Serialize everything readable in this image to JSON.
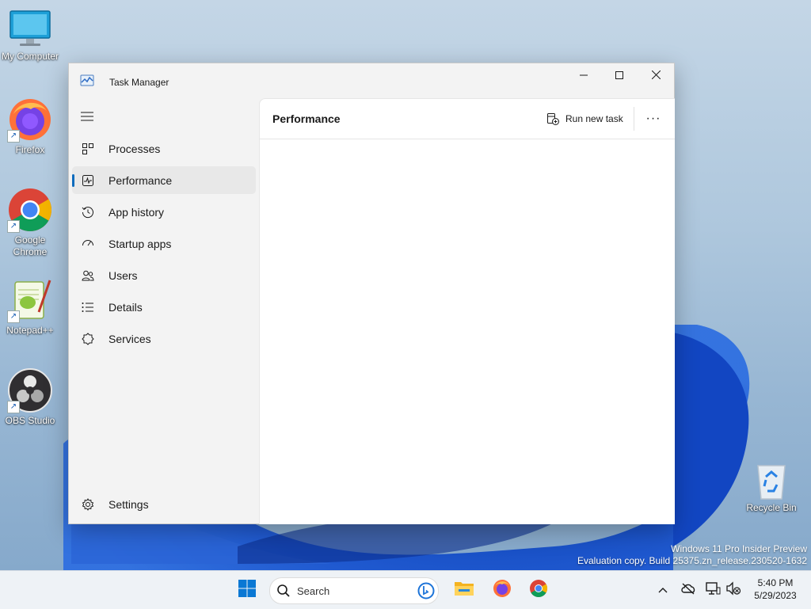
{
  "desktop": {
    "icons": [
      {
        "label": "My Computer"
      },
      {
        "label": "Firefox"
      },
      {
        "label": "Google Chrome"
      },
      {
        "label": "Notepad++"
      },
      {
        "label": "OBS Studio"
      },
      {
        "label": "Recycle Bin"
      }
    ],
    "watermark": {
      "line1": "Windows 11 Pro Insider Preview",
      "line2": "Evaluation copy. Build 25375.zn_release.230520-1632"
    }
  },
  "window": {
    "title": "Task Manager",
    "sidebar": {
      "items": [
        {
          "label": "Processes",
          "icon": "processes-icon"
        },
        {
          "label": "Performance",
          "icon": "performance-icon",
          "active": true
        },
        {
          "label": "App history",
          "icon": "app-history-icon"
        },
        {
          "label": "Startup apps",
          "icon": "startup-apps-icon"
        },
        {
          "label": "Users",
          "icon": "users-icon"
        },
        {
          "label": "Details",
          "icon": "details-icon"
        },
        {
          "label": "Services",
          "icon": "services-icon"
        }
      ],
      "settings_label": "Settings"
    },
    "content": {
      "title": "Performance",
      "run_new_task_label": "Run new task",
      "more_label": "···"
    }
  },
  "taskbar": {
    "search_placeholder": "Search",
    "clock": {
      "time": "5:40 PM",
      "date": "5/29/2023"
    }
  },
  "colors": {
    "accent": "#0f6cbd",
    "window_bg": "#f3f3f3",
    "content_bg": "#ffffff",
    "taskbar_bg": "#eef2f6"
  }
}
